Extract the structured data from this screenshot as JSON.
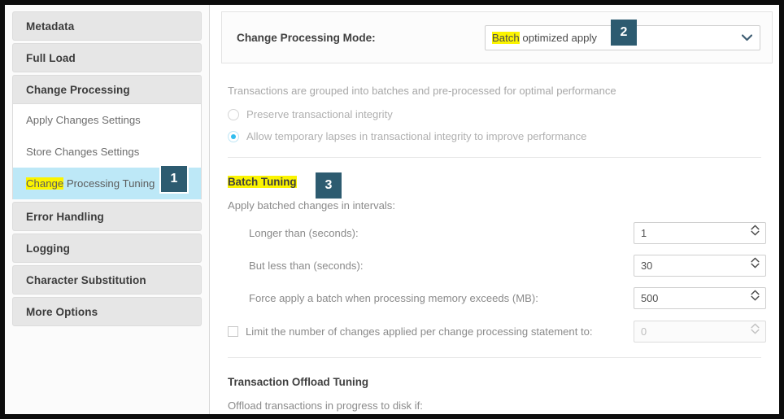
{
  "sidebar": {
    "groups": [
      {
        "label": "Metadata",
        "expanded": false,
        "children": []
      },
      {
        "label": "Full Load",
        "expanded": false,
        "children": []
      },
      {
        "label": "Change Processing",
        "expanded": true,
        "children": [
          {
            "label": "Apply Changes Settings",
            "selected": false,
            "highlight": ""
          },
          {
            "label": "Store Changes Settings",
            "selected": false,
            "highlight": ""
          },
          {
            "label": "Change Processing Tuning",
            "selected": true,
            "highlight": "Change",
            "rest": " Processing Tuning"
          }
        ]
      },
      {
        "label": "Error Handling",
        "expanded": false,
        "children": []
      },
      {
        "label": "Logging",
        "expanded": false,
        "children": []
      },
      {
        "label": "Character Substitution",
        "expanded": false,
        "children": []
      },
      {
        "label": "More Options",
        "expanded": false,
        "children": []
      }
    ]
  },
  "mode_panel": {
    "label": "Change Processing Mode:",
    "select_highlight": "Batch",
    "select_rest": " optimized apply",
    "select_value": "Batch optimized apply",
    "chevron_icon": "chevron-down-icon"
  },
  "mode_section": {
    "description": "Transactions are grouped into batches and pre-processed for optimal performance",
    "radios": [
      {
        "label": "Preserve transactional integrity",
        "checked": false
      },
      {
        "label": "Allow temporary lapses in transactional integrity to improve performance",
        "checked": true
      }
    ]
  },
  "batch_tuning": {
    "title": "Batch Tuning",
    "intro": "Apply batched changes in intervals:",
    "fields": [
      {
        "label": "Longer than (seconds):",
        "value": "1",
        "disabled": false
      },
      {
        "label": "But less than (seconds):",
        "value": "30",
        "disabled": false
      },
      {
        "label": "Force apply a batch when processing memory exceeds (MB):",
        "value": "500",
        "disabled": false
      }
    ],
    "limit_checkbox": {
      "label": "Limit the number of changes applied per change processing statement to:",
      "checked": false,
      "value": "0",
      "disabled": true
    }
  },
  "offload_tuning": {
    "title": "Transaction Offload Tuning",
    "intro": "Offload transactions in progress to disk if:"
  },
  "callouts": [
    {
      "id": "1",
      "number": "1"
    },
    {
      "id": "2",
      "number": "2"
    },
    {
      "id": "3",
      "number": "3"
    }
  ],
  "colors": {
    "badge_bg": "#2d5b70",
    "selected_nav": "#bde8f7",
    "highlight_yellow": "#fbf400",
    "radio_accent": "#31bdee"
  }
}
